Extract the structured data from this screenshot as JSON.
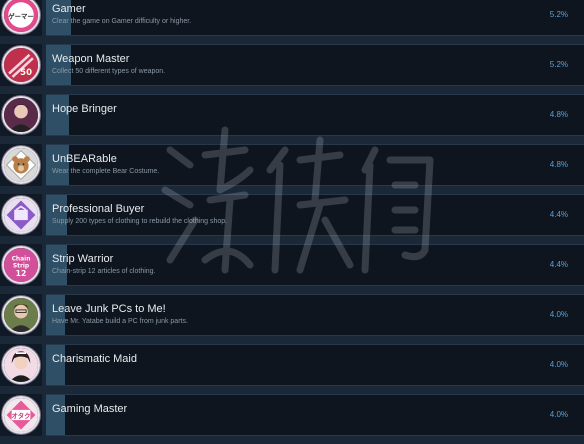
{
  "achievements": [
    {
      "title": "Gamer",
      "description": "Clear the game on Gamer difficulty or higher.",
      "percent": "5.2%",
      "icon": "gamer-badge-icon",
      "icon_text": "ゲーマー",
      "icon_bg": "#e24a8c"
    },
    {
      "title": "Weapon Master",
      "description": "Collect 50 different types of weapon.",
      "percent": "5.2%",
      "icon": "weapon-master-icon",
      "icon_text": "50",
      "icon_bg": "#c0304d"
    },
    {
      "title": "Hope Bringer",
      "description": "",
      "percent": "4.8%",
      "icon": "hope-bringer-portrait-icon",
      "icon_text": "",
      "icon_bg": "#5a2a4a"
    },
    {
      "title": "UnBEARable",
      "description": "Wear the complete Bear Costume.",
      "percent": "4.8%",
      "icon": "bear-costume-icon",
      "icon_text": "",
      "icon_bg": "#ffffff"
    },
    {
      "title": "Professional Buyer",
      "description": "Supply 200 types of clothing to rebuild the clothing shop.",
      "percent": "4.4%",
      "icon": "clothing-shop-icon",
      "icon_text": "",
      "icon_bg": "#8a5bc8"
    },
    {
      "title": "Strip Warrior",
      "description": "Chain-strip 12 articles of clothing.",
      "percent": "4.4%",
      "icon": "chain-strip-icon",
      "icon_text": "Chain Strip 12",
      "icon_bg": "#d24f9a"
    },
    {
      "title": "Leave Junk PCs to Me!",
      "description": "Have Mr. Yatabe build a PC from junk parts.",
      "percent": "4.0%",
      "icon": "junk-pc-portrait-icon",
      "icon_text": "",
      "icon_bg": "#6b7d4a"
    },
    {
      "title": "Charismatic Maid",
      "description": "",
      "percent": "4.0%",
      "icon": "maid-portrait-icon",
      "icon_text": "",
      "icon_bg": "#7a3a5a"
    },
    {
      "title": "Gaming Master",
      "description": "",
      "percent": "4.0%",
      "icon": "otaku-badge-icon",
      "icon_text": "オタク",
      "icon_bg": "#e85a9a"
    }
  ],
  "watermark": {
    "icon": "site-watermark-icon"
  }
}
